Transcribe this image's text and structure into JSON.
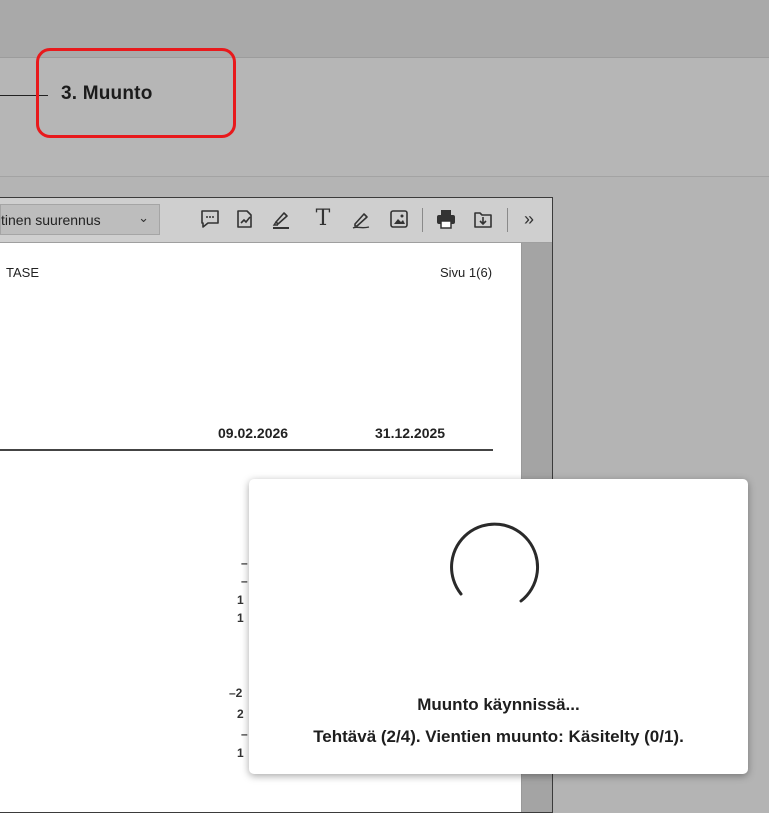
{
  "step": {
    "label": "3. Muunto"
  },
  "viewer": {
    "zoom_value": "tinen suurennus",
    "icons": [
      "comment-icon",
      "sign-icon",
      "highlight-icon",
      "text-icon",
      "draw-icon",
      "image-icon",
      "print-icon",
      "download-icon",
      "more-tools-icon"
    ],
    "text_tool_glyph": "T",
    "more_glyph": "»",
    "dropdown_glyph": "⌄"
  },
  "document": {
    "title": "TASE",
    "page_indicator": "Sivu 1(6)",
    "date_col_1": "09.02.2026",
    "date_col_2": "31.12.2025",
    "fragments": [
      "–",
      "–",
      "1",
      "1",
      "–2",
      "2",
      "–",
      "1"
    ]
  },
  "dialog": {
    "title": "Muunto käynnissä...",
    "status": "Tehtävä (2/4). Vientien muunto: Käsitelty (0/1)."
  },
  "colors": {
    "highlight": "#e8191c",
    "background": "#b4b4b4"
  }
}
